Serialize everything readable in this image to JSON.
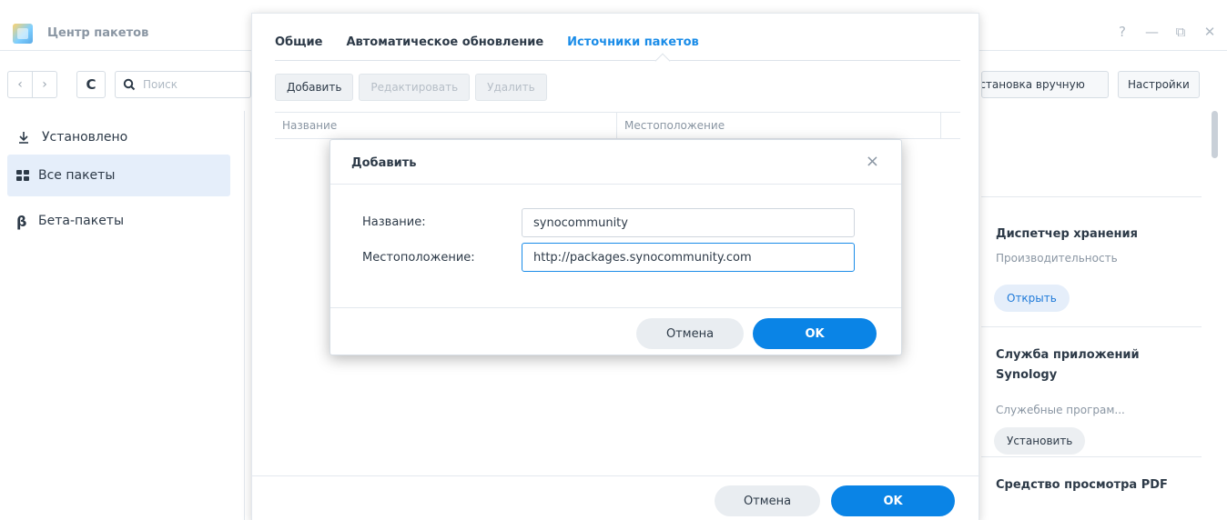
{
  "app": {
    "title": "Центр пакетов",
    "controls": {
      "help": "?",
      "minimize": "—",
      "restore": "⧉",
      "close": "✕"
    }
  },
  "toolbar": {
    "back": "‹",
    "forward": "›",
    "refresh": "C",
    "search_placeholder": "Поиск"
  },
  "sidebar": {
    "items": [
      {
        "label": "Установлено",
        "icon": "download-icon",
        "active": false
      },
      {
        "label": "Все пакеты",
        "icon": "grid-icon",
        "active": true
      },
      {
        "label": "Бета-пакеты",
        "icon": "beta-icon",
        "active": false
      }
    ]
  },
  "right_toolbar": {
    "manual_install": "Установка вручную",
    "settings": "Настройки"
  },
  "cards": [
    {
      "title": "Диспетчер хранения",
      "subtitle": "Производительность",
      "button": "Открыть"
    },
    {
      "title": "Служба приложений Synology",
      "subtitle": "Служебные програм...",
      "button": "Установить"
    },
    {
      "title": "Средство просмотра PDF",
      "subtitle": "",
      "button": ""
    }
  ],
  "settings": {
    "tabs": [
      "Общие",
      "Автоматическое обновление",
      "Источники пакетов"
    ],
    "active_tab": "Источники пакетов",
    "buttons": {
      "add": "Добавить",
      "edit": "Редактировать",
      "delete": "Удалить"
    },
    "columns": {
      "name": "Название",
      "location": "Местоположение"
    },
    "footer": {
      "cancel": "Отмена",
      "ok": "OK"
    }
  },
  "add_dialog": {
    "title": "Добавить",
    "close": "×",
    "name_label": "Название:",
    "name_value": "synocommunity",
    "location_label": "Местоположение:",
    "location_value": "http://packages.synocommunity.com",
    "cancel": "Отмена",
    "ok": "OK"
  },
  "colors": {
    "accent": "#0a84e6",
    "active_tab": "#1a8ce8",
    "sidebar_active": "#e5eefa"
  }
}
